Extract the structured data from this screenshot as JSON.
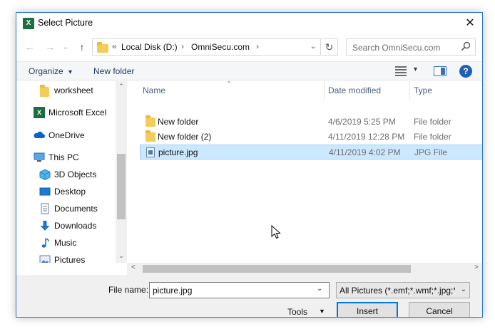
{
  "window": {
    "title": "Select Picture",
    "app_icon": "excel-icon",
    "close_glyph": "✕"
  },
  "nav_buttons": {
    "back": "←",
    "forward": "→",
    "recent": "⌄",
    "up": "↑"
  },
  "address": {
    "prefix": "«",
    "segments": [
      "Local Disk (D:)",
      "OmniSecu.com"
    ],
    "separator": "›",
    "dropdown": "⌄",
    "refresh_glyph": "↻"
  },
  "search": {
    "placeholder": "Search OmniSecu.com"
  },
  "toolbar": {
    "organize_label": "Organize",
    "organize_caret": "▾",
    "new_folder_label": "New folder",
    "view_caret": "▾",
    "help_glyph": "?"
  },
  "nav_pane": {
    "items": [
      {
        "label": "worksheet",
        "icon": "folder-icon"
      },
      {
        "label": "Microsoft Excel",
        "icon": "excel-icon"
      },
      {
        "label": "OneDrive",
        "icon": "onedrive-icon"
      },
      {
        "label": "This PC",
        "icon": "computer-icon"
      },
      {
        "label": "3D Objects",
        "icon": "cube-icon"
      },
      {
        "label": "Desktop",
        "icon": "desktop-icon"
      },
      {
        "label": "Documents",
        "icon": "documents-icon"
      },
      {
        "label": "Downloads",
        "icon": "download-icon"
      },
      {
        "label": "Music",
        "icon": "music-icon"
      },
      {
        "label": "Pictures",
        "icon": "pictures-icon"
      }
    ],
    "scroll_up": "⌃",
    "scroll_down": "⌄"
  },
  "columns": [
    "Name",
    "Date modified",
    "Type"
  ],
  "files": [
    {
      "name": "New folder",
      "date": "4/6/2019 5:25 PM",
      "type": "File folder",
      "icon": "folder-icon",
      "selected": false
    },
    {
      "name": "New folder (2)",
      "date": "4/11/2019 12:28 PM",
      "type": "File folder",
      "icon": "folder-icon",
      "selected": false
    },
    {
      "name": "picture.jpg",
      "date": "4/11/2019 4:02 PM",
      "type": "JPG File",
      "icon": "jpg-file-icon",
      "selected": true
    }
  ],
  "hscroll": {
    "left": "<",
    "right": ">"
  },
  "bottom": {
    "file_name_label": "File name:",
    "file_name_value": "picture.jpg",
    "filter_value": "All Pictures (*.emf;*.wmf;*.jpg;*",
    "caret": "⌄",
    "tools_label": "Tools",
    "tools_caret": "▼",
    "insert_label": "Insert",
    "cancel_label": "Cancel"
  }
}
